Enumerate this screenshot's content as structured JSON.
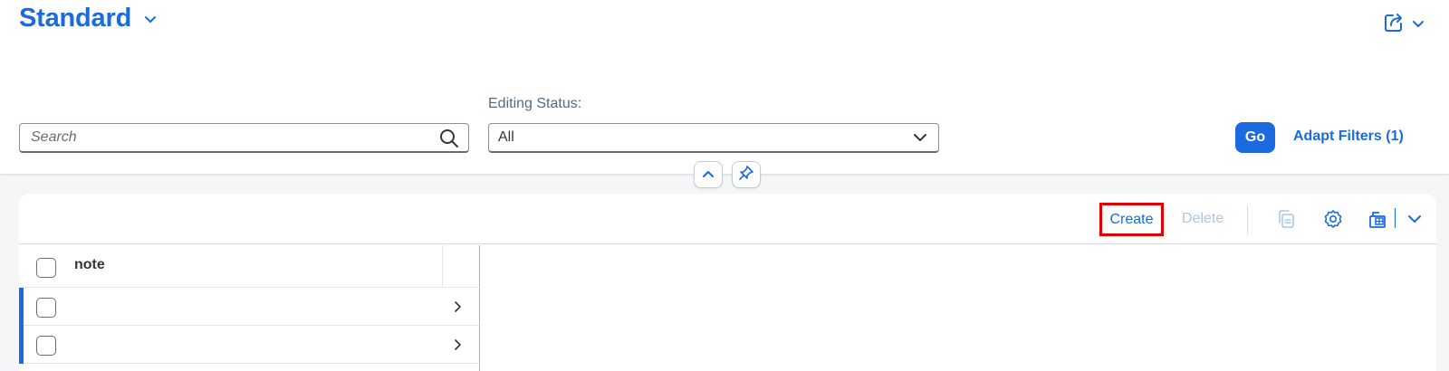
{
  "header": {
    "variant_title": "Standard",
    "icons": {
      "variant_dropdown": "chevron-down-icon",
      "share": "share-icon",
      "share_dropdown": "chevron-down-icon"
    }
  },
  "filters": {
    "search": {
      "placeholder": "Search",
      "value": ""
    },
    "editing_status": {
      "label": "Editing Status:",
      "selected": "All"
    },
    "go_label": "Go",
    "adapt_filters_label": "Adapt Filters (1)"
  },
  "table": {
    "toolbar": {
      "create_label": "Create",
      "delete_label": "Delete",
      "icons": [
        "copy-icon",
        "settings-icon",
        "export-icon",
        "chevron-down-icon"
      ]
    },
    "columns": [
      "note"
    ],
    "rows": [
      {
        "note": ""
      },
      {
        "note": ""
      }
    ]
  },
  "colors": {
    "accent": "#1b6ae0",
    "highlight_border": "#e30000",
    "disabled_text": "#a9c6ef"
  }
}
